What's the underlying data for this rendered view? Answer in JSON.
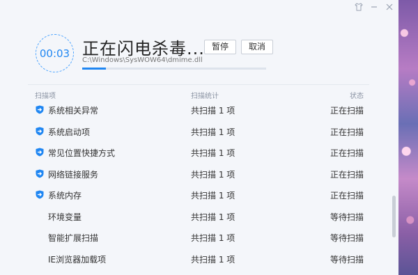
{
  "window": {
    "title_icons": [
      "shirt-icon",
      "minus-icon",
      "close-icon"
    ]
  },
  "scan": {
    "timer": "00:03",
    "heading": "正在闪电杀毒...",
    "pause_label": "暂停",
    "cancel_label": "取消",
    "current_path": "C:\\Windows\\SysWOW64\\dmime.dll",
    "progress": 0.13
  },
  "table": {
    "headers": {
      "name": "扫描项",
      "stats": "扫描统计",
      "status": "状态"
    },
    "rows": [
      {
        "name": "系统相关异常",
        "stats": "共扫描 1 项",
        "status": "正在扫描",
        "icon": true
      },
      {
        "name": "系统启动项",
        "stats": "共扫描 1 项",
        "status": "正在扫描",
        "icon": true
      },
      {
        "name": "常见位置快捷方式",
        "stats": "共扫描 1 项",
        "status": "正在扫描",
        "icon": true
      },
      {
        "name": "网络链接服务",
        "stats": "共扫描 1 项",
        "status": "正在扫描",
        "icon": true
      },
      {
        "name": "系统内存",
        "stats": "共扫描 1 项",
        "status": "正在扫描",
        "icon": true
      },
      {
        "name": "环境变量",
        "stats": "共扫描 1 项",
        "status": "等待扫描",
        "icon": false
      },
      {
        "name": "智能扩展扫描",
        "stats": "共扫描 1 项",
        "status": "等待扫描",
        "icon": false
      },
      {
        "name": "IE浏览器加载项",
        "stats": "共扫描 1 项",
        "status": "等待扫描",
        "icon": false
      }
    ]
  },
  "colors": {
    "accent": "#1f86f2",
    "background": "#f4f6fa"
  }
}
